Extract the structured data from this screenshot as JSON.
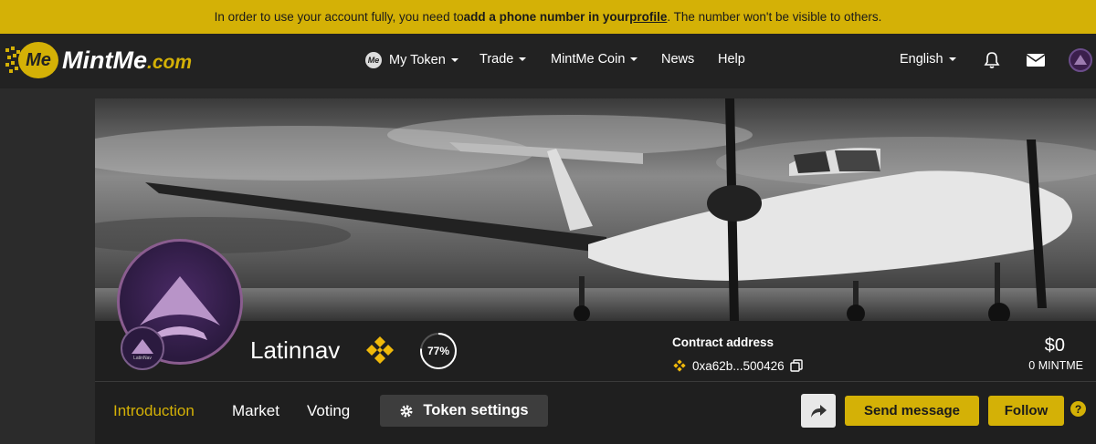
{
  "banner": {
    "text_start": "In order to use your account fully, you need to ",
    "text_bold": "add a phone number in your ",
    "text_link": "profile",
    "text_end": ". The number won't be visible to others."
  },
  "logo": {
    "badge": "Me",
    "name": "MintMe",
    "suffix": ".com"
  },
  "nav": {
    "my_token": "My Token",
    "trade": "Trade",
    "mintme_coin": "MintMe Coin",
    "news": "News",
    "help": "Help",
    "language": "English"
  },
  "token": {
    "name": "Latinnav",
    "avatar_label": "LatinNav",
    "progress": "77%",
    "progress_value": 0.77,
    "contract_label": "Contract address",
    "contract_address": "0xa62b...500426",
    "price": "$0",
    "price_sub": "0 MINTME"
  },
  "tabs": {
    "introduction": "Introduction",
    "market": "Market",
    "voting": "Voting",
    "token_settings": "Token settings"
  },
  "actions": {
    "send_message": "Send message",
    "follow": "Follow",
    "help": "?"
  },
  "colors": {
    "accent": "#d4b106",
    "background": "#2b2b2b",
    "card": "#1f1f1f"
  }
}
